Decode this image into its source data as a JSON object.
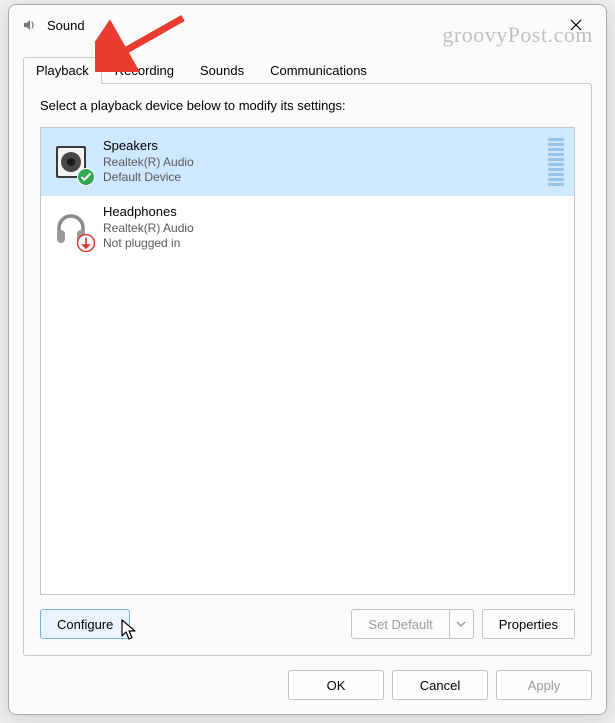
{
  "window": {
    "title": "Sound"
  },
  "tabs": {
    "playback": "Playback",
    "recording": "Recording",
    "sounds": "Sounds",
    "communications": "Communications"
  },
  "instruction": "Select a playback device below to modify its settings:",
  "devices": [
    {
      "name": "Speakers",
      "driver": "Realtek(R) Audio",
      "status": "Default Device",
      "selected": true,
      "badge": "check"
    },
    {
      "name": "Headphones",
      "driver": "Realtek(R) Audio",
      "status": "Not plugged in",
      "selected": false,
      "badge": "down"
    }
  ],
  "panel_buttons": {
    "configure": "Configure",
    "set_default": "Set Default",
    "properties": "Properties"
  },
  "dialog_buttons": {
    "ok": "OK",
    "cancel": "Cancel",
    "apply": "Apply"
  },
  "watermark": "groovyPost.com"
}
